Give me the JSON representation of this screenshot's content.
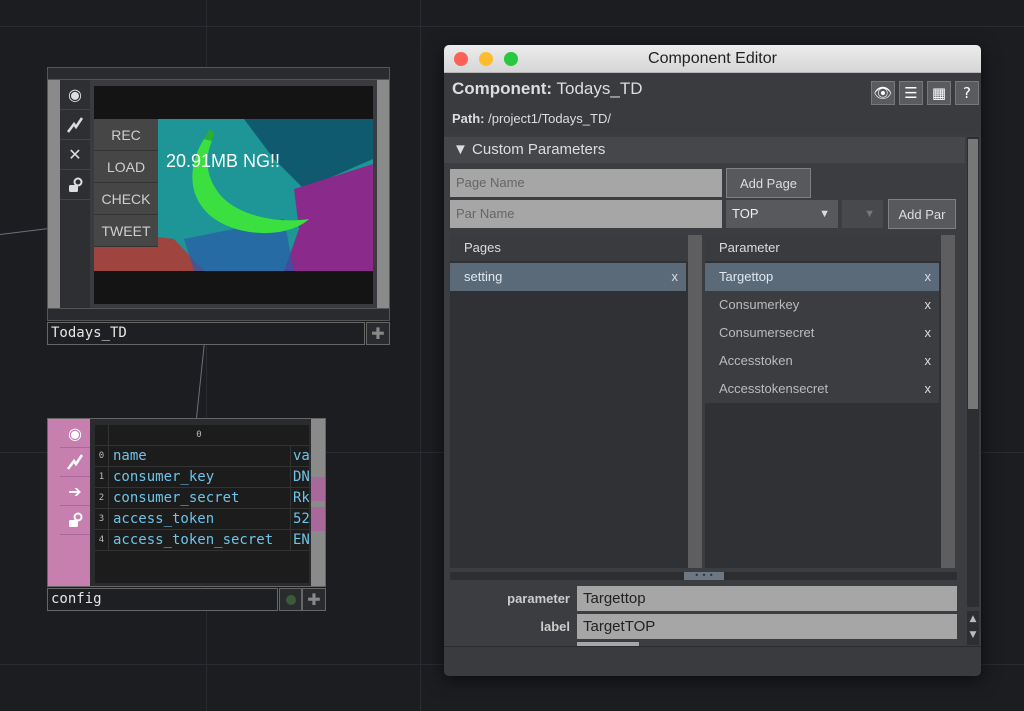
{
  "node_top": {
    "buttons": [
      "REC",
      "LOAD",
      "CHECK",
      "TWEET"
    ],
    "overlay": "20.91MB NG!!",
    "name": "Todays_TD",
    "icons": [
      "viewer-icon",
      "bypass-icon",
      "close-icon",
      "lock-icon"
    ]
  },
  "node_dat": {
    "header": "0",
    "rows": [
      {
        "idx": "0",
        "c0": "name",
        "c1": "va"
      },
      {
        "idx": "1",
        "c0": "consumer_key",
        "c1": "DN"
      },
      {
        "idx": "2",
        "c0": "consumer_secret",
        "c1": "Rk"
      },
      {
        "idx": "3",
        "c0": "access_token",
        "c1": "52"
      },
      {
        "idx": "4",
        "c0": "access_token_secret",
        "c1": "EN"
      }
    ],
    "name": "config"
  },
  "editor": {
    "title": "Component Editor",
    "component_label": "Component:",
    "component_name": "Todays_TD",
    "path_label": "Path:",
    "path_value": "/project1/Todays_TD/",
    "section": "Custom Parameters",
    "page_name_placeholder": "Page Name",
    "add_page": "Add Page",
    "par_name_placeholder": "Par Name",
    "par_type": "TOP",
    "add_par": "Add Par",
    "pages_header": "Pages",
    "pages": [
      "setting"
    ],
    "parameter_header": "Parameter",
    "parameters": [
      "Targettop",
      "Consumerkey",
      "Consumersecret",
      "Accesstoken",
      "Accesstokensecret"
    ],
    "remove_glyph": "x",
    "props": [
      {
        "label": "parameter",
        "value": "Targettop"
      },
      {
        "label": "label",
        "value": "TargetTOP"
      }
    ]
  },
  "colors": {
    "background": "#1c1d21",
    "dat_node": "#c77fb0",
    "selected_row": "#5a6a78",
    "close_light": "#fe5f57",
    "min_light": "#febc2e",
    "max_light": "#28c840"
  }
}
